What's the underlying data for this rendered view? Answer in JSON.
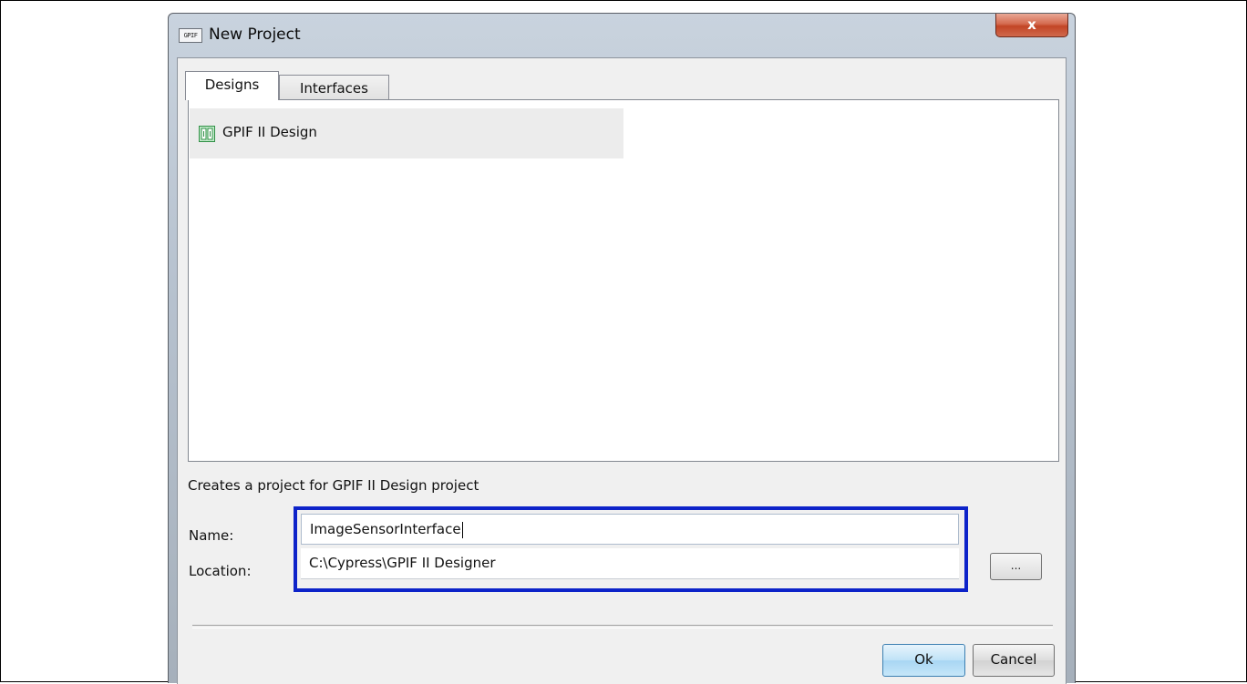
{
  "window": {
    "title": "New Project",
    "app_icon_text": "GPIF",
    "close_glyph": "x"
  },
  "tabs": [
    {
      "label": "Designs",
      "active": true
    },
    {
      "label": "Interfaces",
      "active": false
    }
  ],
  "list": {
    "items": [
      {
        "label": "GPIF II Design",
        "icon": "design-icon",
        "selected": true
      }
    ]
  },
  "description": "Creates a project for GPIF II Design project",
  "form": {
    "name_label": "Name:",
    "name_value": "ImageSensorInterface",
    "location_label": "Location:",
    "location_value": "C:\\Cypress\\GPIF II Designer",
    "browse_label": "..."
  },
  "buttons": {
    "ok": "Ok",
    "cancel": "Cancel"
  },
  "colors": {
    "highlight_border": "#0d23c9",
    "close_button": "#c24526"
  }
}
